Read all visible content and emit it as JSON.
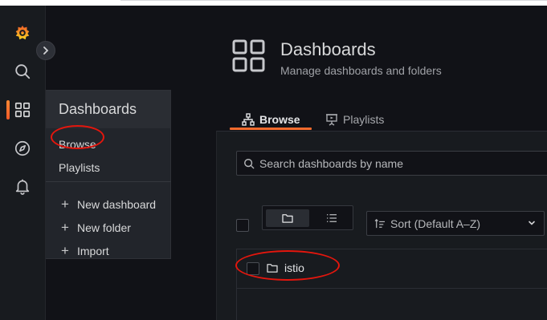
{
  "sidebar": {
    "logo": "grafana-logo",
    "icons": [
      "search-icon",
      "dashboards-grid-icon",
      "explore-compass-icon",
      "alerting-bell-icon"
    ],
    "expand_icon": "chevron-right-icon"
  },
  "flyout": {
    "title": "Dashboards",
    "items": [
      {
        "label": "Browse"
      },
      {
        "label": "Playlists"
      }
    ],
    "actions": [
      {
        "label": "New dashboard",
        "icon": "plus-icon"
      },
      {
        "label": "New folder",
        "icon": "plus-icon"
      },
      {
        "label": "Import",
        "icon": "plus-icon"
      }
    ]
  },
  "header": {
    "title": "Dashboards",
    "subtitle": "Manage dashboards and folders"
  },
  "tabs": [
    {
      "label": "Browse",
      "icon": "sitemap-icon",
      "active": true
    },
    {
      "label": "Playlists",
      "icon": "presentation-icon",
      "active": false
    }
  ],
  "search": {
    "placeholder": "Search dashboards by name"
  },
  "view_toggle": {
    "options": [
      "folder-view-icon",
      "list-view-icon"
    ],
    "selected": "folder-view-icon"
  },
  "sort": {
    "value": "Sort (Default A–Z)"
  },
  "folders": [
    {
      "name": "istio"
    }
  ],
  "annotation_color": "#e4160d",
  "accent_color": "#f56b2d"
}
